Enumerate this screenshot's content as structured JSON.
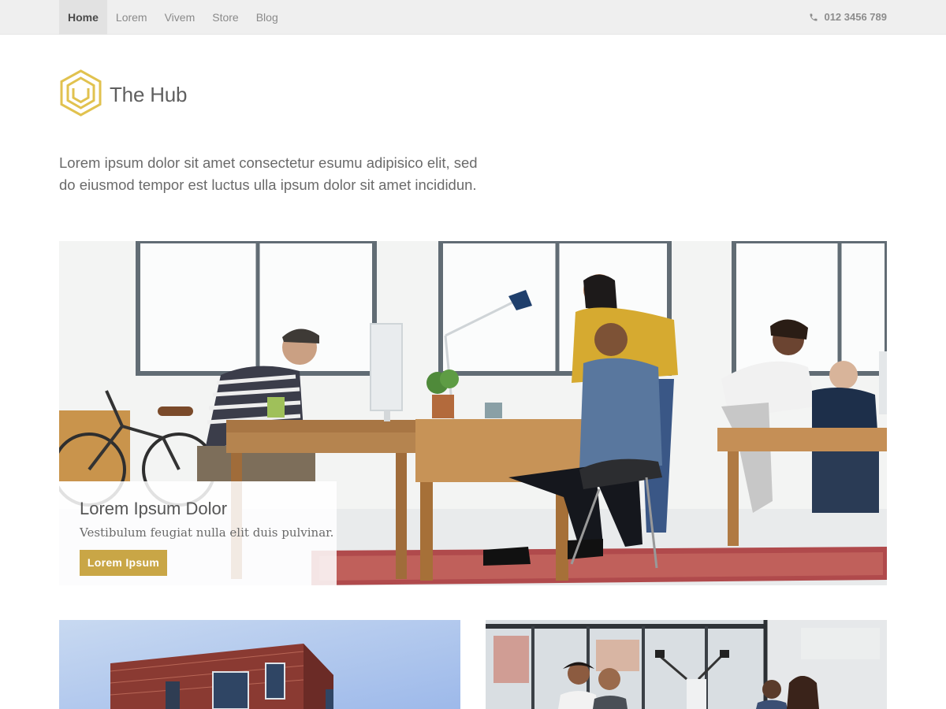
{
  "nav": {
    "items": [
      {
        "label": "Home",
        "active": true
      },
      {
        "label": "Lorem",
        "active": false
      },
      {
        "label": "Vivem",
        "active": false
      },
      {
        "label": "Store",
        "active": false
      },
      {
        "label": "Blog",
        "active": false
      }
    ],
    "phone": "012 3456 789",
    "phone_icon": "phone-icon"
  },
  "brand": {
    "title": "The Hub",
    "logo_icon": "hexagon-logo-icon",
    "accent_color": "#e1c24f"
  },
  "intro": {
    "line1": "Lorem ipsum dolor sit amet consectetur esumu adipisico elit, sed",
    "line2": "do eiusmod tempor est luctus ulla ipsum dolor sit amet incididun."
  },
  "hero": {
    "image": "office-workspace-photo",
    "caption_title": "Lorem Ipsum Dolor",
    "caption_subtitle": "Vestibulum feugiat nulla elit duis pulvinar.",
    "button_label": "Lorem Ipsum",
    "button_color": "#c9a646"
  },
  "cards": [
    {
      "image": "brick-building-photo"
    },
    {
      "image": "office-team-photo"
    }
  ]
}
